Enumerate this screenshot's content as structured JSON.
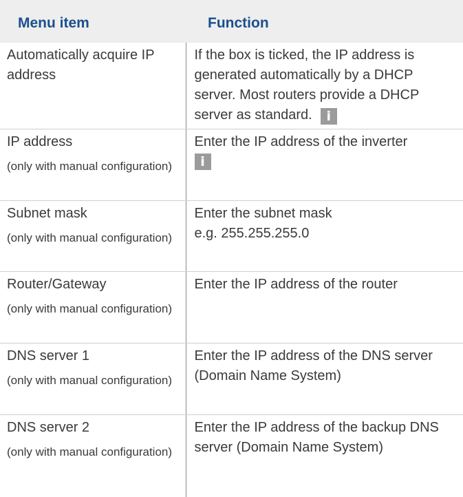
{
  "table": {
    "headers": {
      "menu_item": "Menu item",
      "function": "Function"
    },
    "rows": [
      {
        "menu_item": "Automatically acquire IP address",
        "menu_note": "",
        "function": "If the box is ticked, the IP address is generated automatically by a DHCP server. Most routers provide a DHCP server as standard.",
        "info_icon": true
      },
      {
        "menu_item": "IP address",
        "menu_note": "(only with manual configuration)",
        "function": "Enter the IP address of the inverter",
        "info_icon": true
      },
      {
        "menu_item": "Subnet mask",
        "menu_note": "(only with manual configuration)",
        "function": "Enter the subnet mask",
        "function_line2": "e.g. 255.255.255.0",
        "info_icon": false
      },
      {
        "menu_item": "Router/Gateway",
        "menu_note": "(only with manual configuration)",
        "function": "Enter the IP address of the router",
        "info_icon": false
      },
      {
        "menu_item": "DNS server 1",
        "menu_note": "(only with manual configuration)",
        "function": "Enter the IP address of the DNS server (Domain Name System)",
        "info_icon": false
      },
      {
        "menu_item": "DNS server 2",
        "menu_note": "(only with manual configuration)",
        "function": "Enter the IP address of the backup DNS server (Domain Name System)",
        "info_icon": false
      }
    ],
    "info_icon_glyph": "i"
  },
  "colors": {
    "header_bg": "#eeeeee",
    "header_text": "#1a4f8e",
    "body_text": "#3a3a3a",
    "info_icon_bg": "#9b9b9b"
  },
  "icons": {
    "info": "info-icon"
  }
}
